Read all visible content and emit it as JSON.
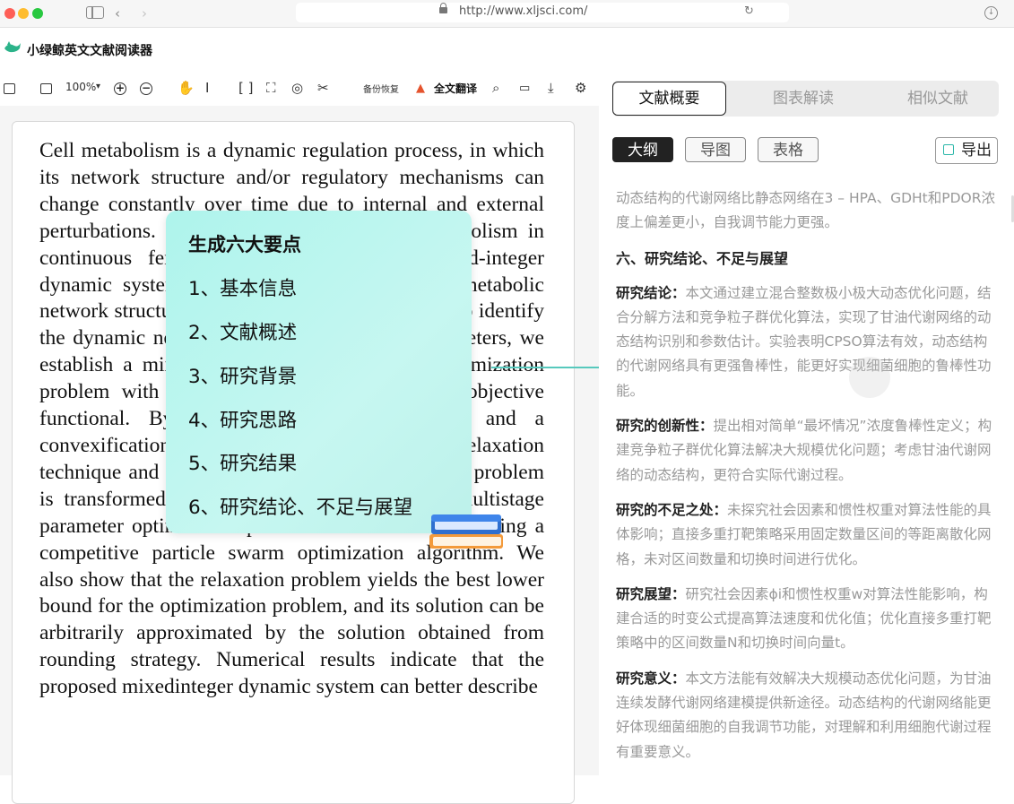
{
  "browser": {
    "url": "http://www.xljsci.com/"
  },
  "app": {
    "name": "小绿鲸英文文献阅读器"
  },
  "toolbar": {
    "zoom": "100%",
    "backup_label": "备份恢复",
    "translate_label": "全文翻译"
  },
  "document": {
    "text": "Cell metabolism is a dynamic regulation process, in which its network structure and/or regulatory mechanisms can change constantly over time due to internal and external perturbations. This paper models glycerol metabolism in continuous fermentation as a nonlinear mixed-integer dynamic system by defining the time-varying metabolic network structure as an integer-valued function. To identify the dynamic network structure and kinetic parameters, we establish a mixed-integer minimax dynamic optimization problem with the biological robustness as its objective functional. By a multiple shooting strategy and a convexification approach consisting of a relaxation technique and rounding strategy, the optimization problem is transformed into a large-scale approximate multistage parameter optimization problem. It is then solved using a competitive particle swarm optimization algorithm. We also show that the relaxation problem yields the best lower bound for the optimization problem, and its solution can be arbitrarily approximated by the solution obtained from rounding strategy. Numerical results indicate that the proposed mixedinteger dynamic system can better describe"
  },
  "popup": {
    "title": "生成六大要点",
    "items": [
      "1、基本信息",
      "2、文献概述",
      "3、研究背景",
      "4、研究思路",
      "5、研究结果",
      "6、研究结论、不足与展望"
    ]
  },
  "panel": {
    "tabs": [
      "文献概要",
      "图表解读",
      "相似文献"
    ],
    "subtabs": [
      "大纲",
      "导图",
      "表格"
    ],
    "export_label": "导出",
    "intro": "动态结构的代谢网络比静态网络在3 – HPA、GDHt和PDOR浓度上偏差更小，自我调节能力更强。",
    "section_heading": "六、研究结论、不足与展望",
    "paragraphs": [
      {
        "label": "研究结论：",
        "text": "本文通过建立混合整数极小极大动态优化问题，结合分解方法和竞争粒子群优化算法，实现了甘油代谢网络的动态结构识别和参数估计。实验表明CPSO算法有效，动态结构的代谢网络具有更强鲁棒性，能更好实现细菌细胞的鲁棒性功能。"
      },
      {
        "label": "研究的创新性：",
        "text": "提出相对简单“最坏情况”浓度鲁棒性定义；构建竞争粒子群优化算法解决大规模优化问题；考虑甘油代谢网络的动态结构，更符合实际代谢过程。"
      },
      {
        "label": "研究的不足之处：",
        "text": "未探究社会因素和惯性权重对算法性能的具体影响；直接多重打靶策略采用固定数量区间的等距离散化网格，未对区间数量和切换时间进行优化。"
      },
      {
        "label": "研究展望：",
        "text": "研究社会因素ϕi和惯性权重w对算法性能影响，构建合适的时变公式提高算法速度和优化值；优化直接多重打靶策略中的区间数量N和切换时间向量t。"
      },
      {
        "label": "研究意义：",
        "text": "本文方法能有效解决大规模动态优化问题，为甘油连续发酵代谢网络建模提供新途径。动态结构的代谢网络能更好体现细菌细胞的自我调节功能，对理解和利用细胞代谢过程有重要意义。"
      }
    ]
  },
  "colors": {
    "popup_bg": "#bdf4ee",
    "connector": "#57c9bd",
    "accent": "#2bb7a9"
  }
}
